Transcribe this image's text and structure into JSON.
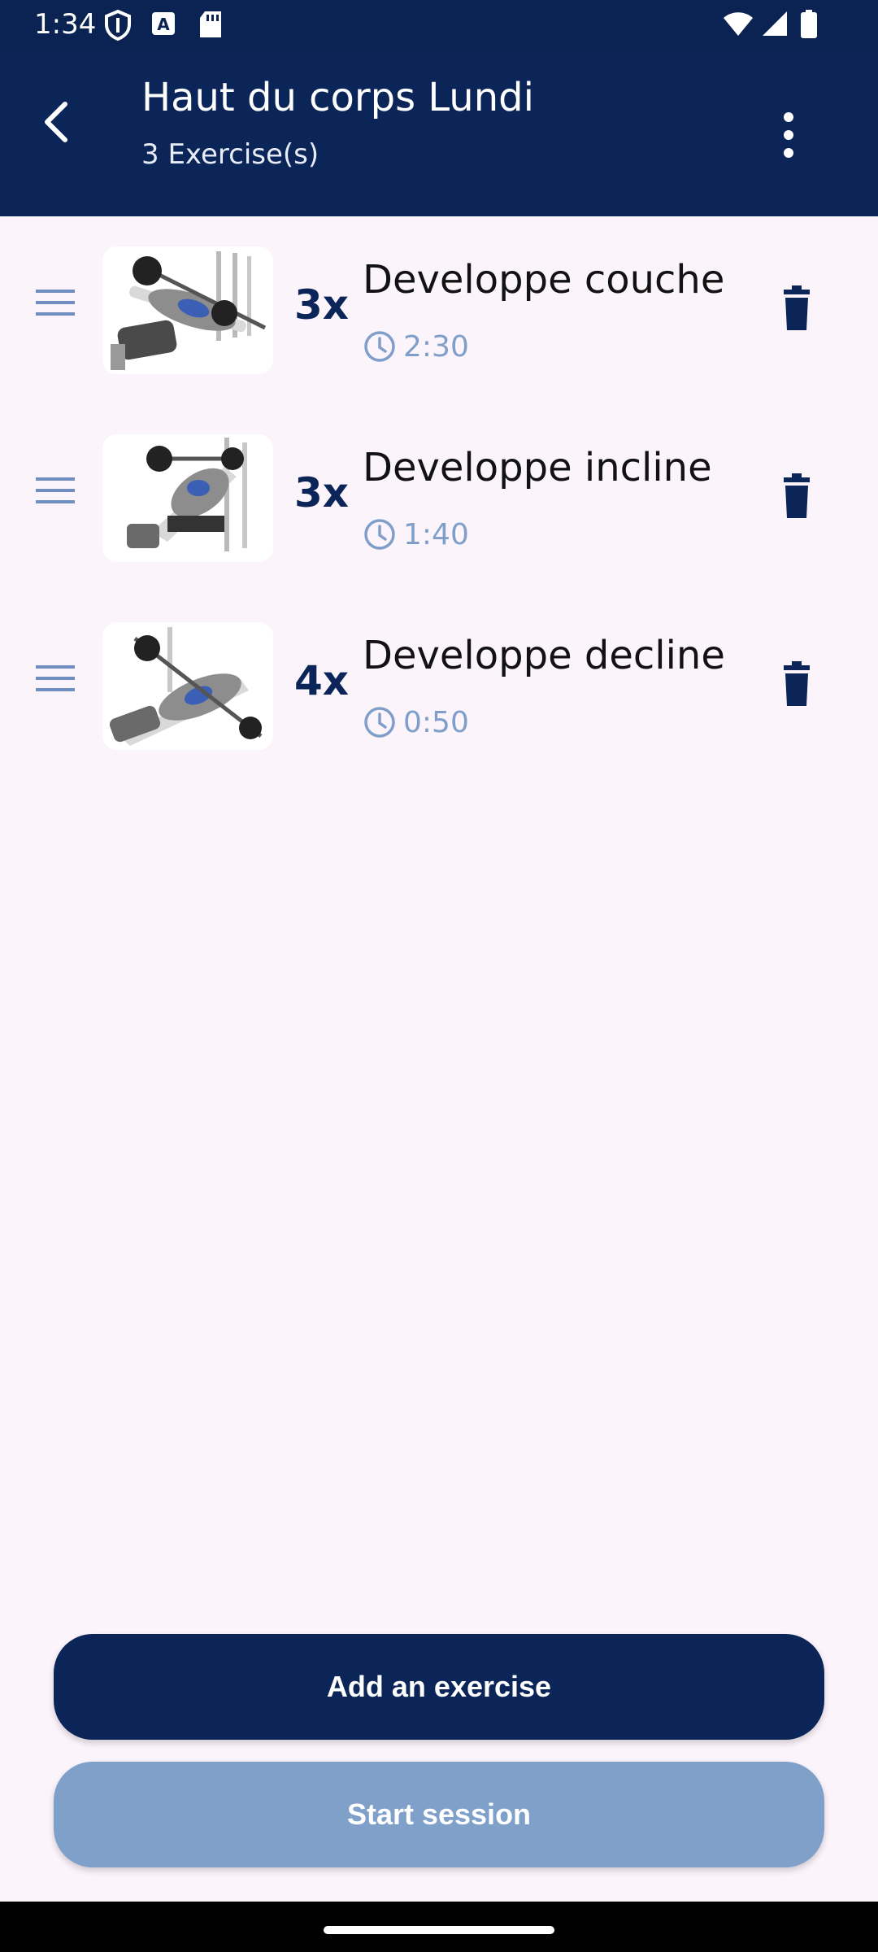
{
  "status_bar": {
    "time": "1:34",
    "icons": [
      "shield-icon",
      "a-notification-icon",
      "sd-card-icon",
      "wifi-icon",
      "cellular-icon",
      "battery-icon"
    ]
  },
  "app_bar": {
    "title": "Haut du corps Lundi",
    "subtitle": "3 Exercise(s)",
    "back_icon": "back-arrow-icon",
    "menu_icon": "more-vert-icon"
  },
  "exercises": [
    {
      "sets": "3x",
      "name": "Developpe couche",
      "rest": "2:30",
      "image": "bench-press-illustration"
    },
    {
      "sets": "3x",
      "name": "Developpe incline",
      "rest": "1:40",
      "image": "incline-press-illustration"
    },
    {
      "sets": "4x",
      "name": "Developpe decline",
      "rest": "0:50",
      "image": "decline-press-illustration"
    }
  ],
  "buttons": {
    "add_label": "Add an exercise",
    "start_label": "Start session"
  },
  "colors": {
    "primary": "#0b2559",
    "background": "#fcf4fb",
    "muted_accent": "#7f9fca",
    "disabled_button": "#7fa0c9"
  }
}
